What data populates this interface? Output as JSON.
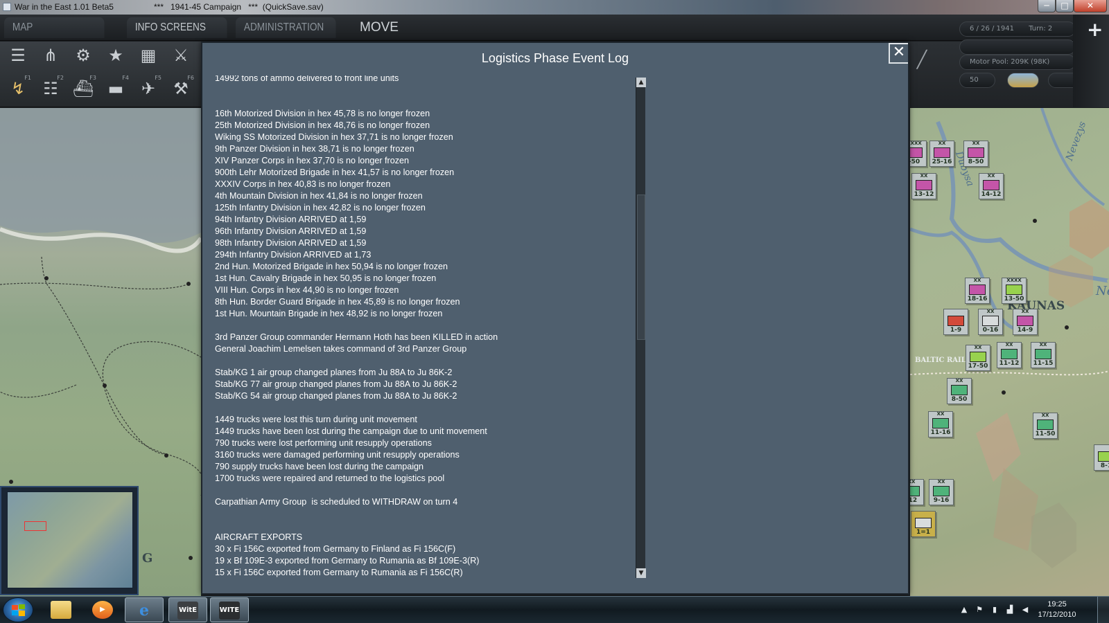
{
  "window": {
    "title_game": "War in the East 1.01 Beta5",
    "title_campaign": "***   1941-45 Campaign   ***  (QuickSave.sav)",
    "minimize": "─",
    "maximize": "□",
    "close": "✕"
  },
  "menu": {
    "map_information": "MAP INFORMATION",
    "info_screens": "INFO SCREENS",
    "administration": "ADMINISTRATION",
    "mode": "MOVE"
  },
  "toolbar": {
    "row1_icons": [
      "layers-icon",
      "unit-sliders-icon",
      "gear-icon",
      "star-icon",
      "weather-icon",
      "combat-icon"
    ],
    "row2_icons": [
      "move-icon",
      "rail-icon",
      "naval-icon",
      "air-icon",
      "air-transport-icon",
      "supply-icon"
    ],
    "function_keys": [
      "F1",
      "F2",
      "F3",
      "F4",
      "F5",
      "F6"
    ]
  },
  "status": {
    "date": "6 / 26 / 1941",
    "turn": "Turn:  2",
    "motor_pool": "Motor Pool:  209K  (98K)",
    "value": "50"
  },
  "dialog": {
    "title": "Logistics Phase Event Log",
    "close_glyph": "✕",
    "lines": [
      "14992 tons of ammo delivered to front line units",
      "",
      "",
      "16th Motorized Division in hex 45,78 is no longer frozen",
      "25th Motorized Division in hex 48,76 is no longer frozen",
      "Wiking SS Motorized Division in hex 37,71 is no longer frozen",
      "9th Panzer Division in hex 38,71 is no longer frozen",
      "XIV Panzer Corps in hex 37,70 is no longer frozen",
      "900th Lehr Motorized Brigade in hex 41,57 is no longer frozen",
      "XXXIV Corps in hex 40,83 is no longer frozen",
      "4th Mountain Division in hex 41,84 is no longer frozen",
      "125th Infantry Division in hex 42,82 is no longer frozen",
      "94th Infantry Division ARRIVED at 1,59",
      "96th Infantry Division ARRIVED at 1,59",
      "98th Infantry Division ARRIVED at 1,59",
      "294th Infantry Division ARRIVED at 1,73",
      "2nd Hun. Motorized Brigade in hex 50,94 is no longer frozen",
      "1st Hun. Cavalry Brigade in hex 50,95 is no longer frozen",
      "VIII Hun. Corps in hex 44,90 is no longer frozen",
      "8th Hun. Border Guard Brigade in hex 45,89 is no longer frozen",
      "1st Hun. Mountain Brigade in hex 48,92 is no longer frozen",
      "",
      "3rd Panzer Group commander Hermann Hoth has been KILLED in action",
      "General Joachim Lemelsen takes command of 3rd Panzer Group",
      "",
      "Stab/KG 1 air group changed planes from Ju 88A to Ju 86K-2",
      "Stab/KG 77 air group changed planes from Ju 88A to Ju 86K-2",
      "Stab/KG 54 air group changed planes from Ju 88A to Ju 86K-2",
      "",
      "1449 trucks were lost this turn during unit movement",
      "1449 trucks have been lost during the campaign due to unit movement",
      "790 trucks were lost performing unit resupply operations",
      "3160 trucks were damaged performing unit resupply operations",
      "790 supply trucks have been lost during the campaign",
      "1700 trucks were repaired and returned to the logistics pool",
      "",
      "Carpathian Army Group  is scheduled to WITHDRAW on turn 4",
      "",
      "",
      "AIRCRAFT EXPORTS",
      "30 x Fi 156C exported from Germany to Finland as Fi 156C(F)",
      "19 x Bf 109E-3 exported from Germany to Rumania as Bf 109E-3(R)",
      "15 x Fi 156C exported from Germany to Rumania as Fi 156C(R)"
    ],
    "scroll_up": "▲",
    "scroll_down": "▼",
    "scroll_position": 0.32
  },
  "map": {
    "place_labels": [
      "KAUNAS",
      "BALTIC RAIL",
      "Dubysa",
      "Nevezys",
      "Ner",
      "G"
    ],
    "units": [
      {
        "echelon": "XXXX",
        "label": "-50",
        "color": "pink",
        "icon": "hq-icon"
      },
      {
        "echelon": "XX",
        "label": "25-16",
        "color": "pink",
        "icon": "infantry-icon"
      },
      {
        "echelon": "XX",
        "label": "8-50",
        "color": "pink",
        "icon": "infantry-icon"
      },
      {
        "echelon": "XX",
        "label": "13-12",
        "color": "pink",
        "icon": "infantry-icon"
      },
      {
        "echelon": "XX",
        "label": "14-12",
        "color": "pink",
        "icon": "infantry-icon"
      },
      {
        "echelon": "XX",
        "label": "18-16",
        "color": "pink",
        "icon": "infantry-icon"
      },
      {
        "echelon": "XXXX",
        "label": "13-50",
        "color": "lgreen",
        "icon": "hq-icon"
      },
      {
        "echelon": "",
        "label": "1-9",
        "color": "red",
        "icon": "security-icon"
      },
      {
        "echelon": "XX",
        "label": "0-16",
        "color": "gray",
        "icon": "anchor-icon"
      },
      {
        "echelon": "XX",
        "label": "14-9",
        "color": "pink",
        "icon": "infantry-icon"
      },
      {
        "echelon": "XX",
        "label": "17-50",
        "color": "lgreen",
        "icon": "infantry-icon"
      },
      {
        "echelon": "XX",
        "label": "11-12",
        "color": "green",
        "icon": "infantry-icon"
      },
      {
        "echelon": "XX",
        "label": "11-15",
        "color": "green",
        "icon": "infantry-icon"
      },
      {
        "echelon": "XX",
        "label": "8-50",
        "color": "green",
        "icon": "infantry-icon"
      },
      {
        "echelon": "XX",
        "label": "11-16",
        "color": "green",
        "icon": "infantry-icon"
      },
      {
        "echelon": "XX",
        "label": "11-50",
        "color": "green",
        "icon": "infantry-icon"
      },
      {
        "echelon": "XX",
        "label": "-12",
        "color": "green",
        "icon": "infantry-icon"
      },
      {
        "echelon": "XX",
        "label": "9-16",
        "color": "green",
        "icon": "infantry-icon"
      },
      {
        "echelon": "",
        "label": "1=1",
        "color": "gray",
        "icon": "rail-gun-icon"
      },
      {
        "echelon": "",
        "label": "8-1",
        "color": "lgreen",
        "icon": "infantry-icon"
      }
    ]
  },
  "taskbar": {
    "apps": [
      "file-explorer-icon",
      "media-player-icon",
      "internet-explorer-icon",
      "witw-launcher-icon",
      "witw-game-icon"
    ],
    "app_labels": [
      "WitE",
      "WITE"
    ],
    "time": "19:25",
    "date": "17/12/2010"
  },
  "colors": {
    "dialog_bg": "#4f5f6e",
    "unit_axis": "#c455a8",
    "unit_soviet": "#4fb37a"
  }
}
